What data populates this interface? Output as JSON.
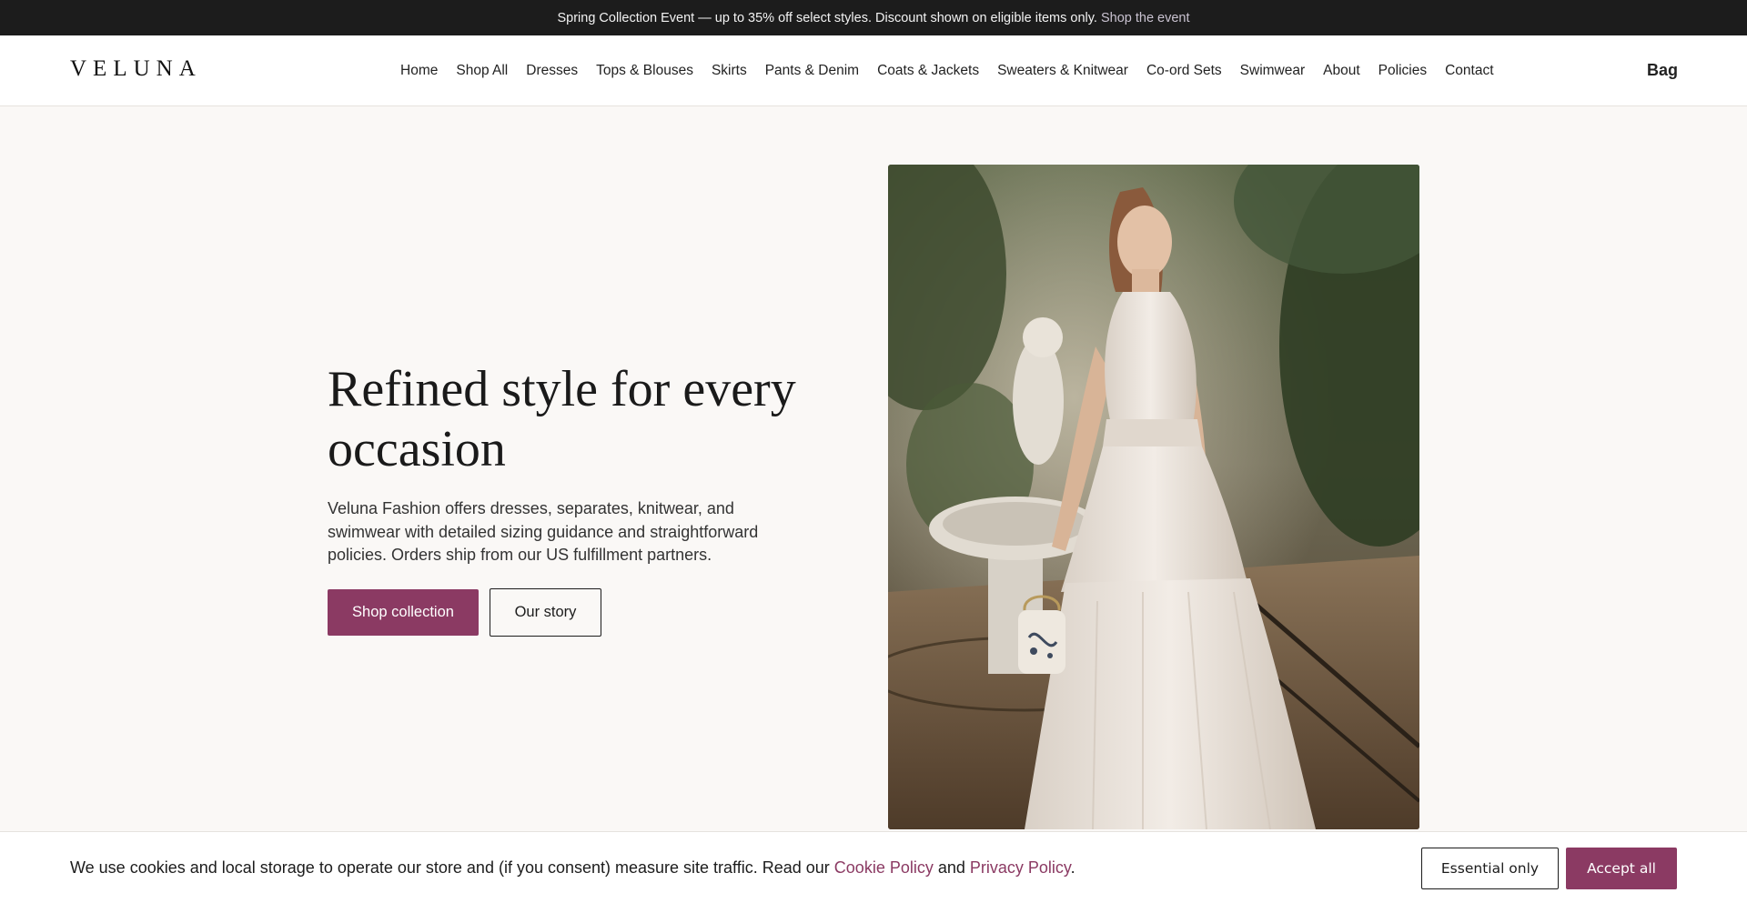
{
  "announcement": {
    "text": "Spring Collection Event — up to 35% off select styles. Discount shown on eligible items only.",
    "link": "Shop the event"
  },
  "header": {
    "logo": "VELUNA",
    "nav": [
      "Home",
      "Shop All",
      "Dresses",
      "Tops & Blouses",
      "Skirts",
      "Pants & Denim",
      "Coats & Jackets",
      "Sweaters & Knitwear",
      "Co-ord Sets",
      "Swimwear",
      "About",
      "Policies",
      "Contact"
    ],
    "bag": "Bag"
  },
  "hero": {
    "title": "Refined style for every occasion",
    "subtitle": "Veluna Fashion offers dresses, separates, knitwear, and swimwear with detailed sizing guidance and straightforward policies. Orders ship from our US fulfillment partners.",
    "primary_button": "Shop collection",
    "secondary_button": "Our story"
  },
  "cookie": {
    "text_before": "We use cookies and local storage to operate our store and (if you consent) measure site traffic. Read our ",
    "cookie_link": "Cookie Policy",
    "and": " and ",
    "privacy_link": "Privacy Policy",
    "text_after": ".",
    "essential_button": "Essential only",
    "accept_button": "Accept all"
  },
  "colors": {
    "accent": "#8b3a63",
    "announcement_bg": "#1c1c1c",
    "page_bg": "#faf8f6"
  }
}
